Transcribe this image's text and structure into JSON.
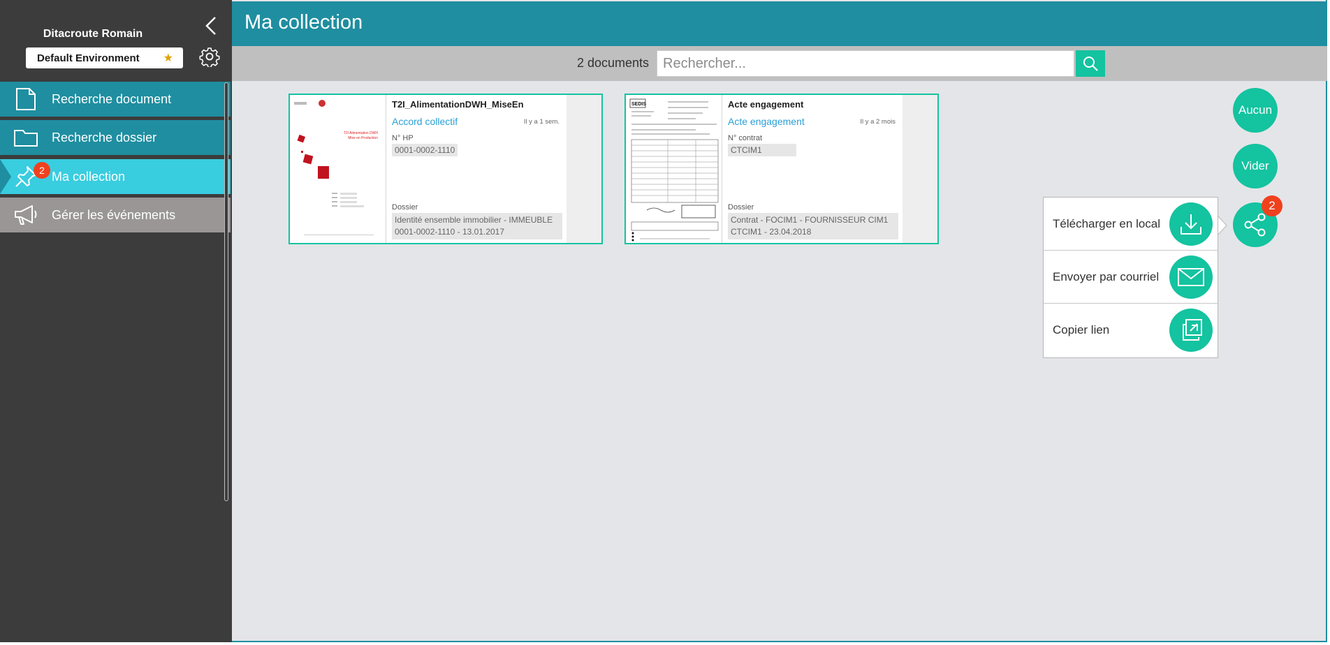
{
  "sidebar": {
    "user_name": "Ditacroute Romain",
    "environment": "Default Environment",
    "items": [
      {
        "label": "Recherche document"
      },
      {
        "label": "Recherche dossier"
      },
      {
        "label": "Ma collection",
        "badge": "2"
      },
      {
        "label": "Gérer les événements"
      }
    ]
  },
  "header": {
    "title": "Ma collection"
  },
  "toolbar": {
    "count": "2 documents",
    "search_placeholder": "Rechercher..."
  },
  "cards": [
    {
      "title": "T2I_AlimentationDWH_MiseEn",
      "type": "Accord collectif",
      "time": "Il y a 1 sem.",
      "field_label": "N° HP",
      "field_value": "0001-0002-1110",
      "dossier_label": "Dossier",
      "dossier_line1": "Identité ensemble immobilier - IMMEUBLE",
      "dossier_line2": "0001-0002-1110 - 13.01.2017",
      "thumb_title": "T2I Alimentation DWH",
      "thumb_subtitle": "Mise en Production"
    },
    {
      "title": "Acte engagement",
      "type": "Acte engagement",
      "time": "Il y a 2 mois",
      "field_label": "N° contrat",
      "field_value": "CTCIM1",
      "dossier_label": "Dossier",
      "dossier_line1": "Contrat - FOCIM1 - FOURNISSEUR CIM1",
      "dossier_line2": "CTCIM1 - 23.04.2018",
      "thumb_title": "SEDIS"
    }
  ],
  "actions": {
    "none_label": "Aucun",
    "clear_label": "Vider",
    "share_badge": "2"
  },
  "share_menu": [
    {
      "label": "Télécharger en local",
      "icon": "download-icon"
    },
    {
      "label": "Envoyer par courriel",
      "icon": "mail-icon"
    },
    {
      "label": "Copier lien",
      "icon": "copy-link-icon"
    }
  ],
  "colors": {
    "teal": "#1f8ea0",
    "accent": "#14c3a0",
    "active": "#39cde0",
    "badge": "#f0411e",
    "sidebar_bg": "#3c3c3c"
  }
}
